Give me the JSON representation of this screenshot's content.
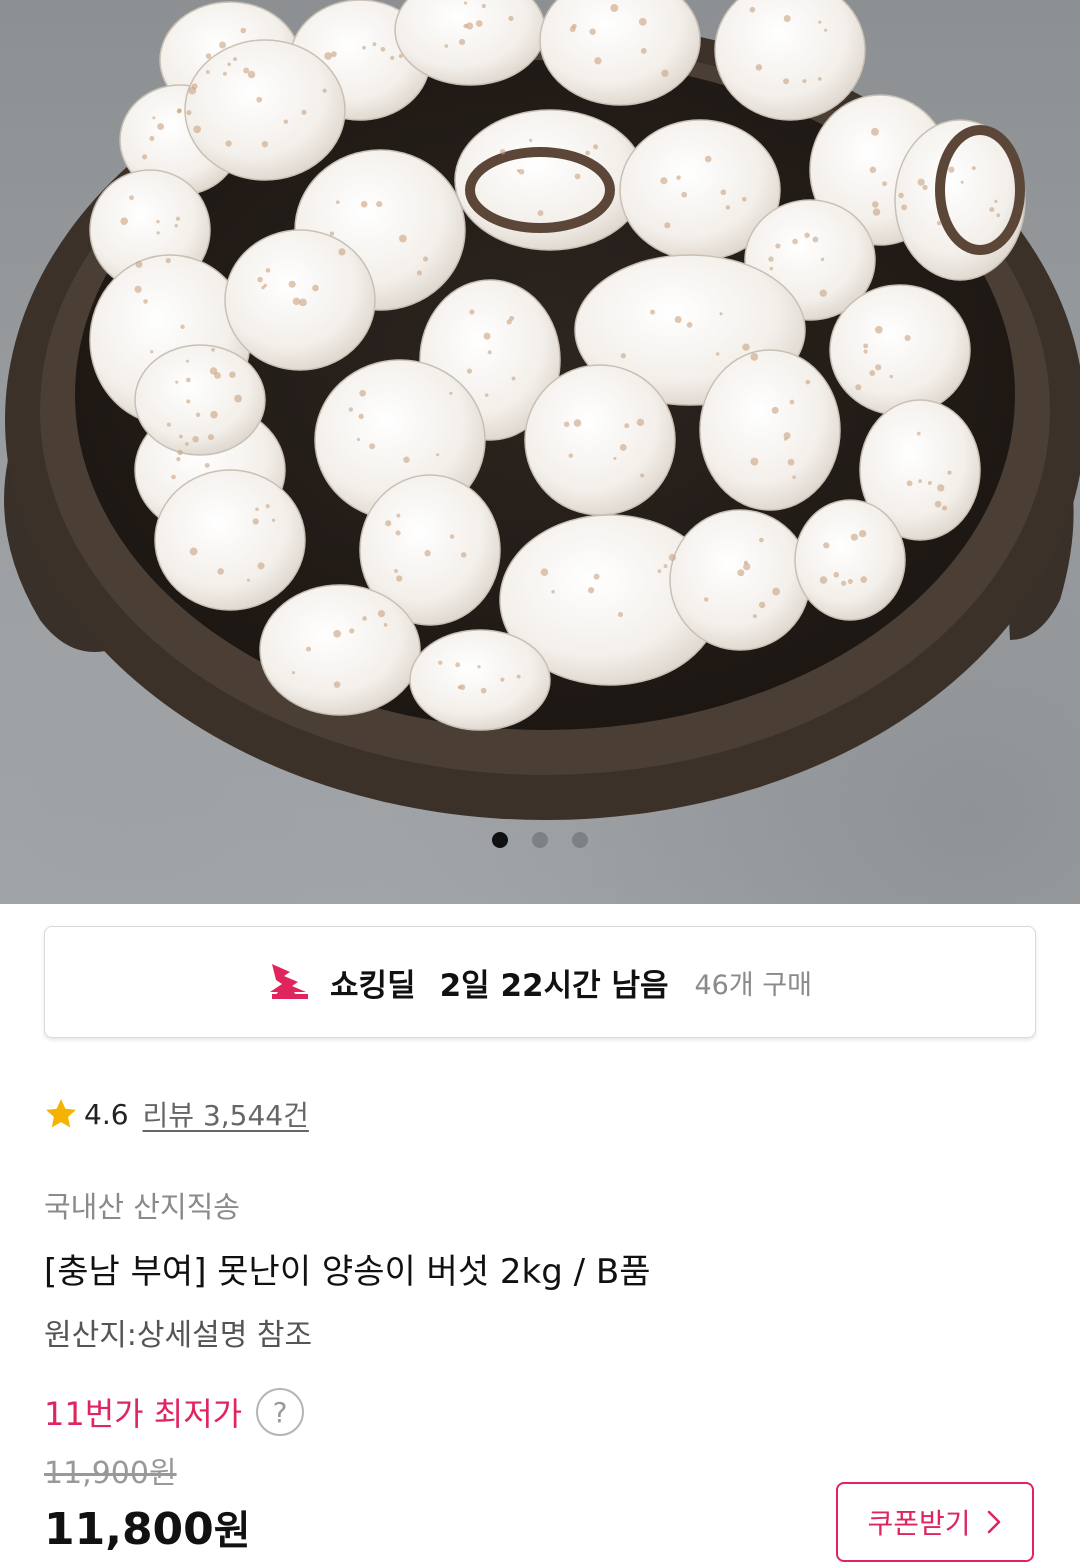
{
  "gallery": {
    "image_alt": "",
    "page_count": 3,
    "active_index": 0
  },
  "deal": {
    "name": "쇼킹딜",
    "remaining": "2일 22시간 남음",
    "purchase_count": "46개 구매",
    "icon": "shocking-deal-icon",
    "accent_color": "#e0245e"
  },
  "rating": {
    "score": "4.6",
    "reviews": "리뷰 3,544건",
    "icon": "star-icon",
    "star_color": "#f5b301"
  },
  "product": {
    "seller_tag": "국내산 산지직송",
    "title": "[충남 부여] 못난이 양송이 버섯 2kg / B품",
    "origin": "원산지:상세설명 참조"
  },
  "price": {
    "lowest_label": "11번가 최저가",
    "help_symbol": "?",
    "original": "11,900원",
    "sale_amount": "11,800",
    "sale_unit": "원",
    "accent_color": "#e0245e"
  },
  "coupon": {
    "label": "쿠폰받기",
    "icon": "chevron-right-icon"
  }
}
